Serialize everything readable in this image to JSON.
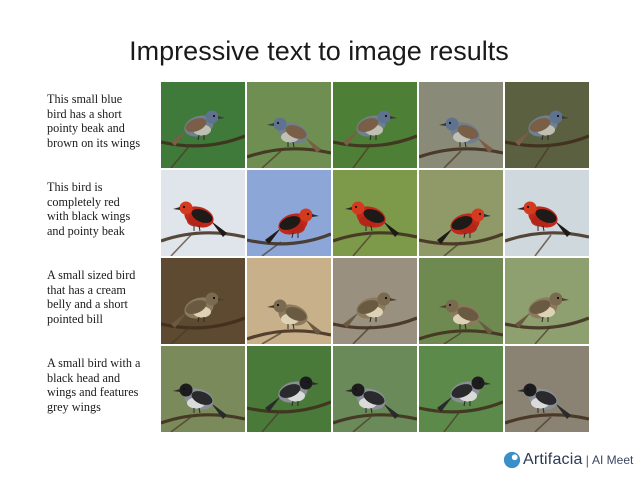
{
  "slide": {
    "title": "Impressive text to image results"
  },
  "rows": [
    {
      "caption": [
        "This small blue",
        "bird has a short",
        "pointy beak and",
        "brown on its wings"
      ],
      "bird": {
        "body": "#6f7f8e",
        "head": "#5f7290",
        "wing": "#7a5e45",
        "belly": "#c9c6b8",
        "beak": "#3a3a3a"
      },
      "backgrounds": [
        "#3f7a3a",
        "#6f8f52",
        "#4e7f36",
        "#8a8a78",
        "#5a6040"
      ]
    },
    {
      "caption": [
        "This bird is",
        "completely red",
        "with black wings",
        "and pointy beak"
      ],
      "bird": {
        "body": "#c0281c",
        "head": "#d43a1e",
        "wing": "#1e1a18",
        "belly": "#b22417",
        "beak": "#2a2a2a"
      },
      "backgrounds": [
        "#dfe5ea",
        "#8ca6d8",
        "#7c9a4a",
        "#8f9a68",
        "#cfd8dc"
      ]
    },
    {
      "caption": [
        "A small sized bird",
        "that has a cream",
        "belly and a short",
        "pointed bill"
      ],
      "bird": {
        "body": "#8c7a5c",
        "head": "#7a6a50",
        "wing": "#6a5a42",
        "belly": "#e6dcc0",
        "beak": "#4a4030"
      },
      "backgrounds": [
        "#5e4a30",
        "#c8b08a",
        "#9a9080",
        "#6f8a50",
        "#8fa070"
      ]
    },
    {
      "caption": [
        "A small bird with a",
        "black head and",
        "wings and features",
        "grey wings"
      ],
      "bird": {
        "body": "#8a8f96",
        "head": "#1c1c1e",
        "wing": "#2a2a2c",
        "belly": "#e2e2e2",
        "beak": "#2a2a2a"
      },
      "backgrounds": [
        "#7a8a5a",
        "#4a7a3a",
        "#6a8a5a",
        "#5c8a4a",
        "#8a8272"
      ]
    }
  ],
  "logo": {
    "name": "Artifacia",
    "separator": "|",
    "tag": "AI Meet",
    "mark_color": "#3b8fc8"
  }
}
